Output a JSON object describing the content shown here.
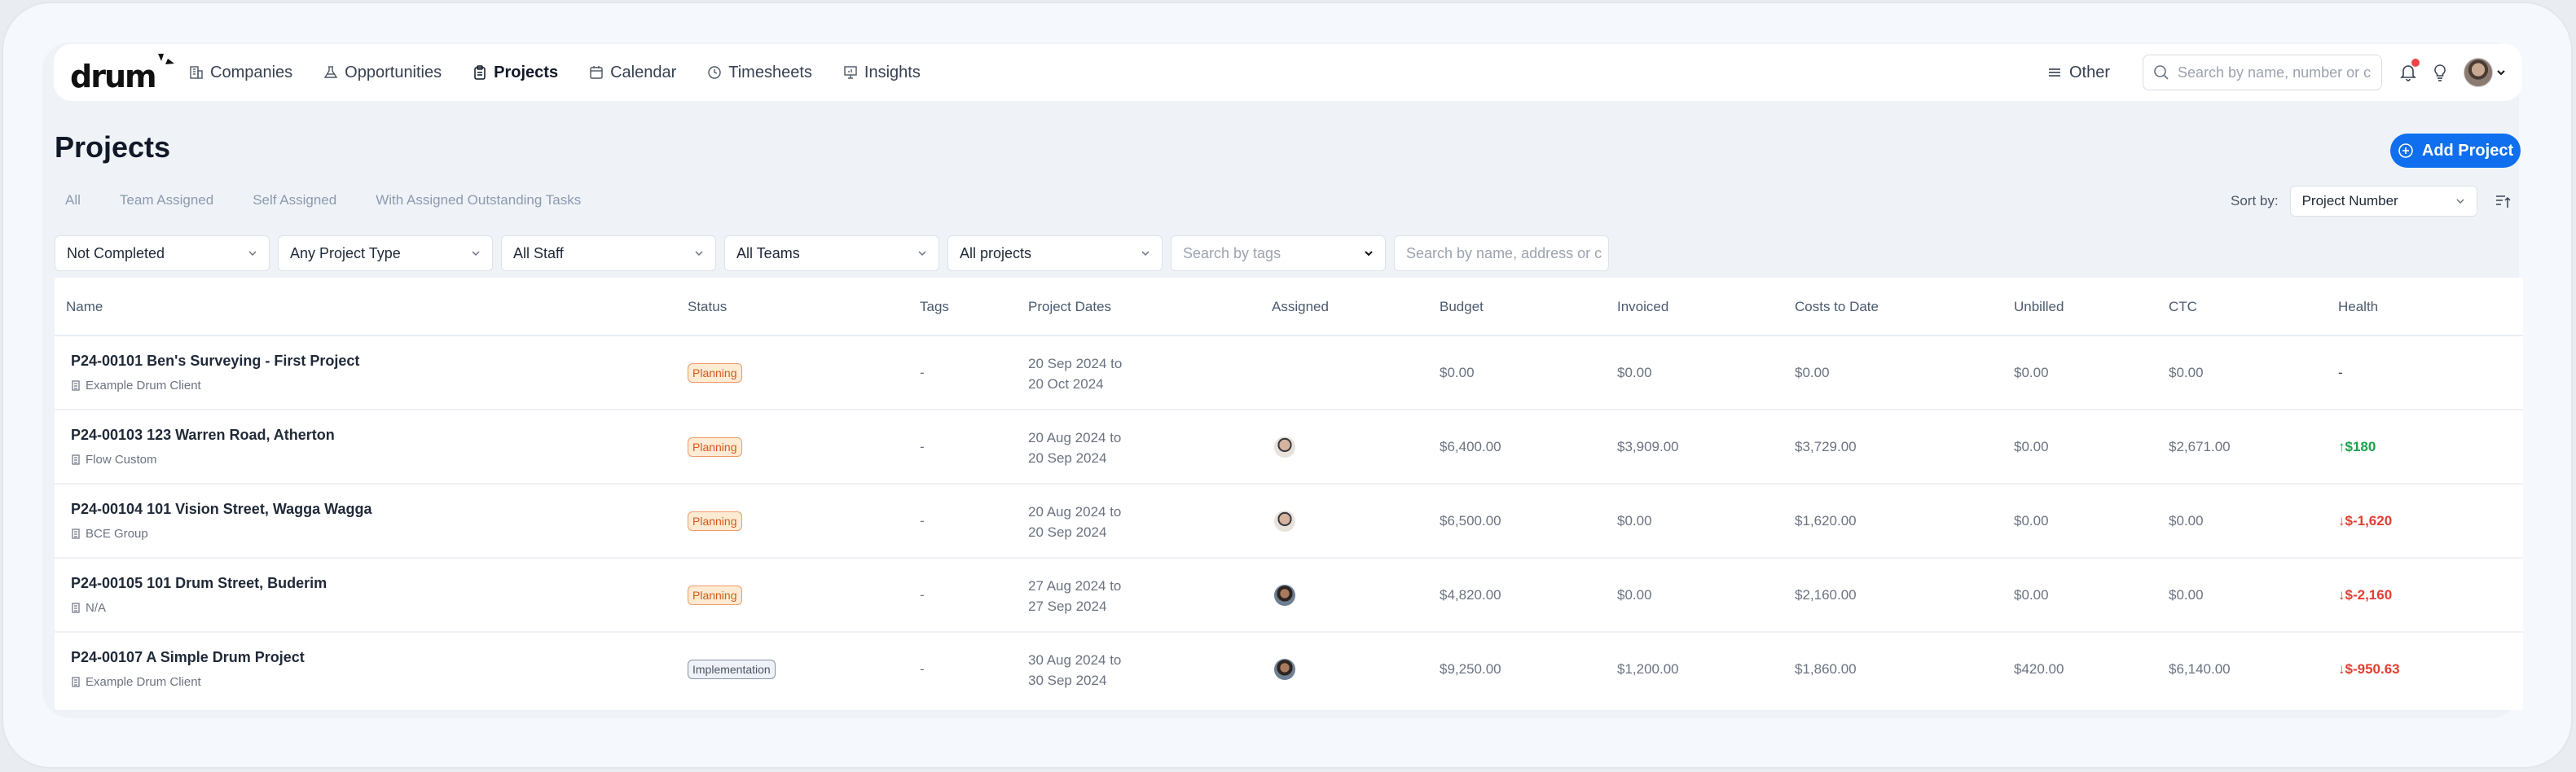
{
  "brand": {
    "logo_text": "drum",
    "accent": "#0f6fee"
  },
  "nav": {
    "items": [
      {
        "label": "Companies",
        "icon": "building-icon",
        "active": false
      },
      {
        "label": "Opportunities",
        "icon": "flask-icon",
        "active": false
      },
      {
        "label": "Projects",
        "icon": "clipboard-icon",
        "active": true
      },
      {
        "label": "Calendar",
        "icon": "calendar-icon",
        "active": false
      },
      {
        "label": "Timesheets",
        "icon": "clock-icon",
        "active": false
      },
      {
        "label": "Insights",
        "icon": "presentation-chart-icon",
        "active": false
      }
    ],
    "other_label": "Other",
    "search_placeholder": "Search by name, number or c"
  },
  "page": {
    "title": "Projects",
    "add_button": "Add Project",
    "tabs": [
      "All",
      "Team Assigned",
      "Self Assigned",
      "With Assigned Outstanding Tasks"
    ],
    "sort_label": "Sort by:",
    "sort_value": "Project Number"
  },
  "filters": {
    "status": "Not Completed",
    "project_type": "Any Project Type",
    "staff": "All Staff",
    "teams": "All Teams",
    "projects": "All projects",
    "tags_placeholder": "Search by tags",
    "search_placeholder": "Search by name, address or c"
  },
  "table": {
    "columns": [
      "Name",
      "Status",
      "Tags",
      "Project Dates",
      "Assigned",
      "Budget",
      "Invoiced",
      "Costs to Date",
      "Unbilled",
      "CTC",
      "Health"
    ],
    "rows": [
      {
        "name": "P24-00101 Ben's Surveying - First Project",
        "client": "Example Drum Client",
        "status": "Planning",
        "tags": "-",
        "date_start": "20 Sep 2024 to",
        "date_end": "20 Oct 2024",
        "assigned": "",
        "budget": "$0.00",
        "invoiced": "$0.00",
        "costs": "$0.00",
        "unbilled": "$0.00",
        "ctc": "$0.00",
        "health": "-",
        "health_trend": "none"
      },
      {
        "name": "P24-00103 123 Warren Road, Atherton",
        "client": "Flow Custom",
        "status": "Planning",
        "tags": "-",
        "date_start": "20 Aug 2024 to",
        "date_end": "20 Sep 2024",
        "assigned": "staff-avatar-1",
        "budget": "$6,400.00",
        "invoiced": "$3,909.00",
        "costs": "$3,729.00",
        "unbilled": "$0.00",
        "ctc": "$2,671.00",
        "health": "↑$180",
        "health_trend": "up"
      },
      {
        "name": "P24-00104 101 Vision Street, Wagga Wagga",
        "client": "BCE Group",
        "status": "Planning",
        "tags": "-",
        "date_start": "20 Aug 2024 to",
        "date_end": "20 Sep 2024",
        "assigned": "staff-avatar-1",
        "budget": "$6,500.00",
        "invoiced": "$0.00",
        "costs": "$1,620.00",
        "unbilled": "$0.00",
        "ctc": "$0.00",
        "health": "↓$-1,620",
        "health_trend": "down"
      },
      {
        "name": "P24-00105 101 Drum Street, Buderim",
        "client": "N/A",
        "status": "Planning",
        "tags": "-",
        "date_start": "27 Aug 2024 to",
        "date_end": "27 Sep 2024",
        "assigned": "staff-avatar-2",
        "budget": "$4,820.00",
        "invoiced": "$0.00",
        "costs": "$2,160.00",
        "unbilled": "$0.00",
        "ctc": "$0.00",
        "health": "↓$-2,160",
        "health_trend": "down"
      },
      {
        "name": "P24-00107 A Simple Drum Project",
        "client": "Example Drum Client",
        "status": "Implementation",
        "tags": "-",
        "date_start": "30 Aug 2024 to",
        "date_end": "30 Sep 2024",
        "assigned": "staff-avatar-2",
        "budget": "$9,250.00",
        "invoiced": "$1,200.00",
        "costs": "$1,860.00",
        "unbilled": "$420.00",
        "ctc": "$6,140.00",
        "health": "↓$-950.63",
        "health_trend": "down"
      }
    ]
  }
}
